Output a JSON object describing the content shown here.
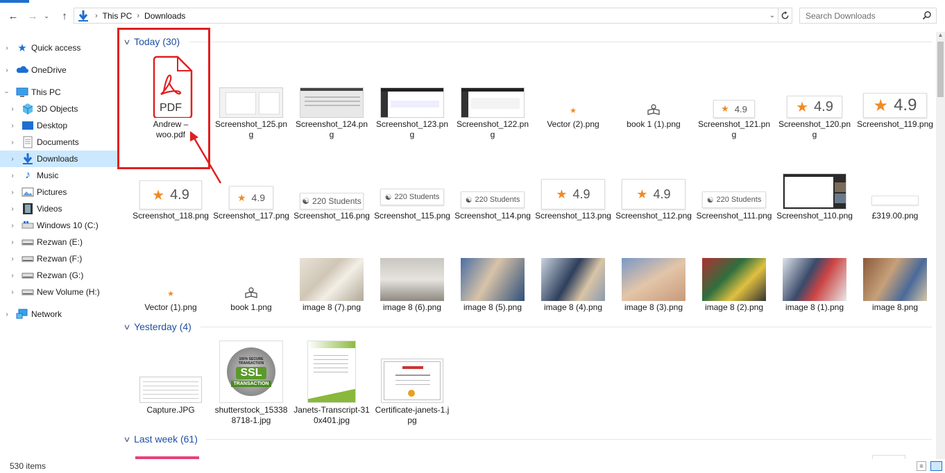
{
  "address": {
    "crumbs": [
      "This PC",
      "Downloads"
    ]
  },
  "search": {
    "placeholder": "Search Downloads"
  },
  "sidebar": {
    "items": [
      {
        "label": "Quick access"
      },
      {
        "label": "OneDrive"
      },
      {
        "label": "This PC"
      },
      {
        "label": "3D Objects"
      },
      {
        "label": "Desktop"
      },
      {
        "label": "Documents"
      },
      {
        "label": "Downloads"
      },
      {
        "label": "Music"
      },
      {
        "label": "Pictures"
      },
      {
        "label": "Videos"
      },
      {
        "label": "Windows 10 (C:)"
      },
      {
        "label": "Rezwan  (E:)"
      },
      {
        "label": "Rezwan (F:)"
      },
      {
        "label": "Rezwan (G:)"
      },
      {
        "label": "New Volume (H:)"
      },
      {
        "label": "Network"
      }
    ]
  },
  "groups": {
    "today": "Today (30)",
    "yesterday": "Yesterday (4)",
    "lastweek": "Last week (61)"
  },
  "files": {
    "row1": [
      {
        "name": "Andrew –\nwoo.pdf",
        "thumb_text": "PDF"
      },
      {
        "name": "Screenshot_125.png"
      },
      {
        "name": "Screenshot_124.png"
      },
      {
        "name": "Screenshot_123.png"
      },
      {
        "name": "Screenshot_122.png"
      },
      {
        "name": "Vector (2).png"
      },
      {
        "name": "book 1 (1).png"
      },
      {
        "name": "Screenshot_121.png",
        "rating": "4.9"
      },
      {
        "name": "Screenshot_120.png",
        "rating": "4.9"
      },
      {
        "name": "Screenshot_119.png",
        "rating": "4.9"
      }
    ],
    "row2": [
      {
        "name": "Screenshot_118.png",
        "rating": "4.9"
      },
      {
        "name": "Screenshot_117.png",
        "rating": "4.9"
      },
      {
        "name": "Screenshot_116.png",
        "students": "220 Students"
      },
      {
        "name": "Screenshot_115.png",
        "students": "220 Students"
      },
      {
        "name": "Screenshot_114.png",
        "students": "220 Students"
      },
      {
        "name": "Screenshot_113.png",
        "rating": "4.9"
      },
      {
        "name": "Screenshot_112.png",
        "rating": "4.9"
      },
      {
        "name": "Screenshot_111.png",
        "students": "220 Students"
      },
      {
        "name": "Screenshot_110.png"
      },
      {
        "name": "£319.00.png"
      }
    ],
    "row3": [
      {
        "name": "Vector (1).png"
      },
      {
        "name": "book 1.png"
      },
      {
        "name": "image 8 (7).png"
      },
      {
        "name": "image 8 (6).png"
      },
      {
        "name": "image 8 (5).png"
      },
      {
        "name": "image 8 (4).png"
      },
      {
        "name": "image 8 (3).png"
      },
      {
        "name": "image 8 (2).png"
      },
      {
        "name": "image 8 (1).png"
      },
      {
        "name": "image 8.png"
      }
    ],
    "yesterday": [
      {
        "name": "Capture.JPG"
      },
      {
        "name": "shutterstock_153388718-1.jpg",
        "badge_top": "100% SECURE TRANSACTION",
        "badge_main": "SSL",
        "badge_sub": "TRANSACTION"
      },
      {
        "name": "Janets-Transcript-310x401.jpg"
      },
      {
        "name": "Certificate-janets-1.jpg"
      }
    ]
  },
  "status": {
    "count": "530 items"
  },
  "colors": {
    "accent": "#1e6fd1",
    "selection": "#cce8ff",
    "annotation": "#e02020",
    "star": "#f08a24"
  }
}
